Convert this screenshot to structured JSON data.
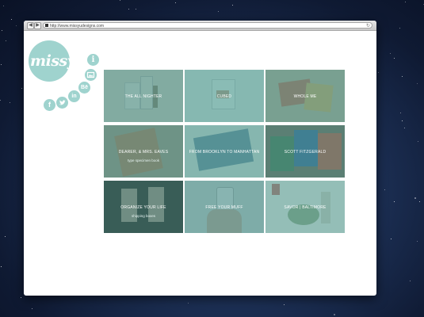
{
  "browser": {
    "back_glyph": "◀",
    "forward_glyph": "▶",
    "url": "http://www.missyudesigns.com",
    "reload_glyph": "↻"
  },
  "brand": {
    "logo_text": "missyu",
    "accent_color": "#9fd3ce"
  },
  "social_icons": [
    {
      "name": "info-icon",
      "glyph": "i"
    },
    {
      "name": "image-icon",
      "glyph": ""
    },
    {
      "name": "behance-icon",
      "glyph": "Bē"
    },
    {
      "name": "linkedin-icon",
      "glyph": "in"
    },
    {
      "name": "twitter-icon",
      "glyph": ""
    },
    {
      "name": "facebook-icon",
      "glyph": "f"
    }
  ],
  "projects": [
    {
      "title": "THE ALL NIGHTER",
      "subtitle": "",
      "overlay": "#5f9b93"
    },
    {
      "title": "CUBED",
      "subtitle": "",
      "overlay": "#5fa59c"
    },
    {
      "title": "WHOLE ME",
      "subtitle": "",
      "overlay": "#5e9b90"
    },
    {
      "title": "DEARER, & MRS. EAVES",
      "subtitle": "type specimen book",
      "overlay": "#5b958c"
    },
    {
      "title": "FROM BROOKLYN TO MANHATTAN",
      "subtitle": "",
      "overlay": "#5aa29b"
    },
    {
      "title": "SCOTT FITZGERALD",
      "subtitle": "",
      "overlay": "#4f8d86"
    },
    {
      "title": "ORGANIZE YOUR LIFE",
      "subtitle": "shipping boxes",
      "overlay": "#3e6b66"
    },
    {
      "title": "FREE YOUR MUFF",
      "subtitle": "",
      "overlay": "#5b9a95"
    },
    {
      "title": "SAVOR | BALTIMORE",
      "subtitle": "",
      "overlay": "#6aa8a1"
    }
  ]
}
